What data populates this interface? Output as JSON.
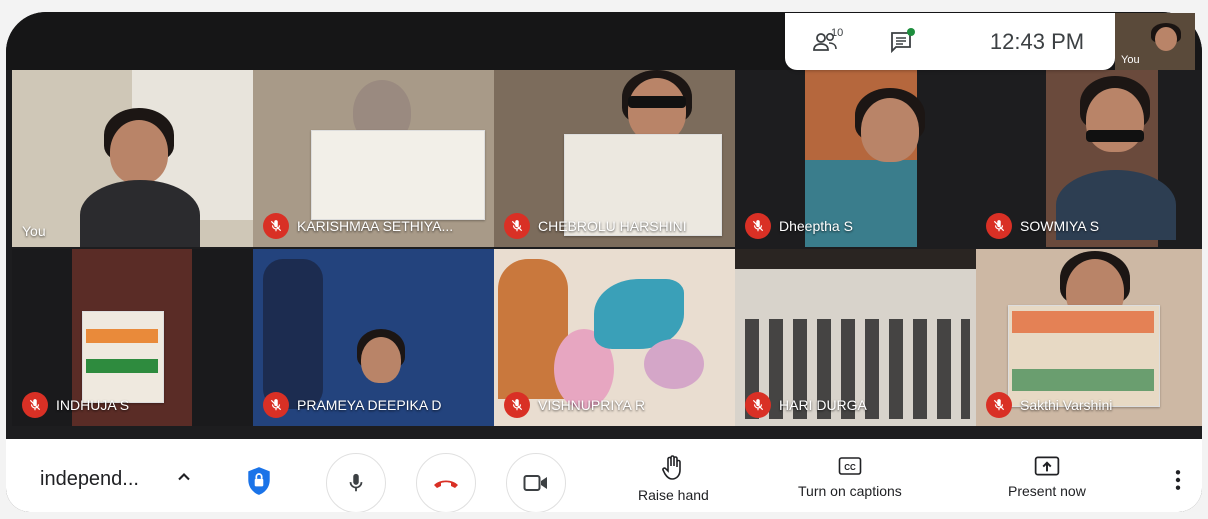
{
  "top_panel": {
    "people_icon": "people-icon",
    "people_count": "10",
    "chat_icon": "chat-icon",
    "time": "12:43 PM",
    "self_label": "You"
  },
  "tiles": [
    {
      "name": "You",
      "muted": false,
      "bg": "#cfc7b7",
      "row": 0,
      "col": 0
    },
    {
      "name": "KARISHMAA SETHIYA...",
      "muted": true,
      "bg": "#a89a88",
      "row": 0,
      "col": 1
    },
    {
      "name": "CHEBROLU HARSHINI",
      "muted": true,
      "bg": "#7c6c5c",
      "row": 0,
      "col": 2
    },
    {
      "name": "Dheeptha S",
      "muted": true,
      "bg": "#b5673d",
      "row": 0,
      "col": 3
    },
    {
      "name": "SOWMIYA S",
      "muted": true,
      "bg": "#6a4a3c",
      "row": 0,
      "col": 4
    },
    {
      "name": "INDHUJA S",
      "muted": true,
      "bg": "#5a2c26",
      "row": 1,
      "col": 0
    },
    {
      "name": "PRAMEYA DEEPIKA D",
      "muted": true,
      "bg": "#23437d",
      "row": 1,
      "col": 1
    },
    {
      "name": "VISHNUPRIYA R",
      "muted": true,
      "bg": "#e9ddd0",
      "row": 1,
      "col": 2
    },
    {
      "name": "HARI DURGA",
      "muted": true,
      "bg": "#d8d3cb",
      "row": 1,
      "col": 3
    },
    {
      "name": "Sakthi Varshini",
      "muted": true,
      "bg": "#cdb8a4",
      "row": 1,
      "col": 4
    }
  ],
  "bottom_bar": {
    "meeting_name": "independ...",
    "caret_icon": "chevron-up-icon",
    "security_icon": "shield-lock-icon",
    "mic_icon": "mic-icon",
    "hangup_icon": "hang-up-icon",
    "camera_icon": "video-camera-icon",
    "raise_hand": "Raise hand",
    "captions": "Turn on captions",
    "present": "Present now",
    "more_icon": "more-vert-icon"
  },
  "colors": {
    "mute_red": "#d93025",
    "hangup_red": "#d93025",
    "security_blue": "#1a73e8",
    "chat_dot_green": "#1e8e3e"
  }
}
